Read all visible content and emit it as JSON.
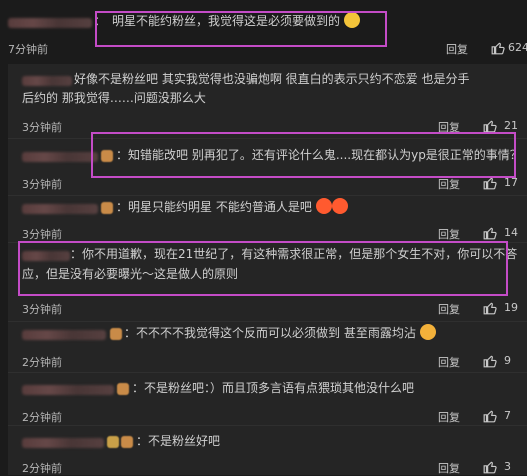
{
  "top": {
    "time": "7分钟前",
    "text": "明星不能约粉丝，我觉得这是必须要做到的",
    "reply_label": "回复",
    "like_count": "624"
  },
  "replies": [
    {
      "text_line1": "好像不是粉丝吧  其实我觉得也没骗炮啊  很直白的表示只约不恋爱  也是分手",
      "text_line2": "后约的  那我觉得……问题没那么大",
      "time": "3分钟前",
      "reply_label": "回复",
      "like_count": "21"
    },
    {
      "text": "知错能改吧 别再犯了。还有评论什么鬼....现在都认为yp是很正常的事情？",
      "time": "3分钟前",
      "reply_label": "回复",
      "like_count": "17"
    },
    {
      "text": "明星只能约明星   不能约普通人是吧",
      "time": "3分钟前",
      "reply_label": "回复",
      "like_count": "14"
    },
    {
      "text_line1": "你不用道歉，现在21世纪了，有这种需求很正常，但是那个女生不对，你可以不答",
      "text_line2": "应，但是没有必要曝光～这是做人的原则",
      "time": "3分钟前",
      "reply_label": "回复",
      "like_count": "19"
    },
    {
      "text": "不不不不我觉得这个反而可以必须做到  甚至雨露均沾",
      "time": "2分钟前",
      "reply_label": "回复",
      "like_count": "9"
    },
    {
      "text": "不是粉丝吧：）而且顶多言语有点猥琐其他没什么吧",
      "time": "2分钟前",
      "reply_label": "回复",
      "like_count": "7"
    },
    {
      "text": "不是粉丝好吧",
      "time": "2分钟前",
      "reply_label": "回复",
      "like_count": "3"
    }
  ],
  "icons": {
    "like": "thumbs-up-icon",
    "emoji_smile": "smiling-emoji-icon",
    "emoji_grin": "laughing-emoji-icon",
    "emoji_sweat": "sweat-smile-emoji-icon"
  },
  "colors": {
    "background": "#1b1b1b",
    "reply_background": "#252525",
    "highlight": "#c44cc7"
  }
}
